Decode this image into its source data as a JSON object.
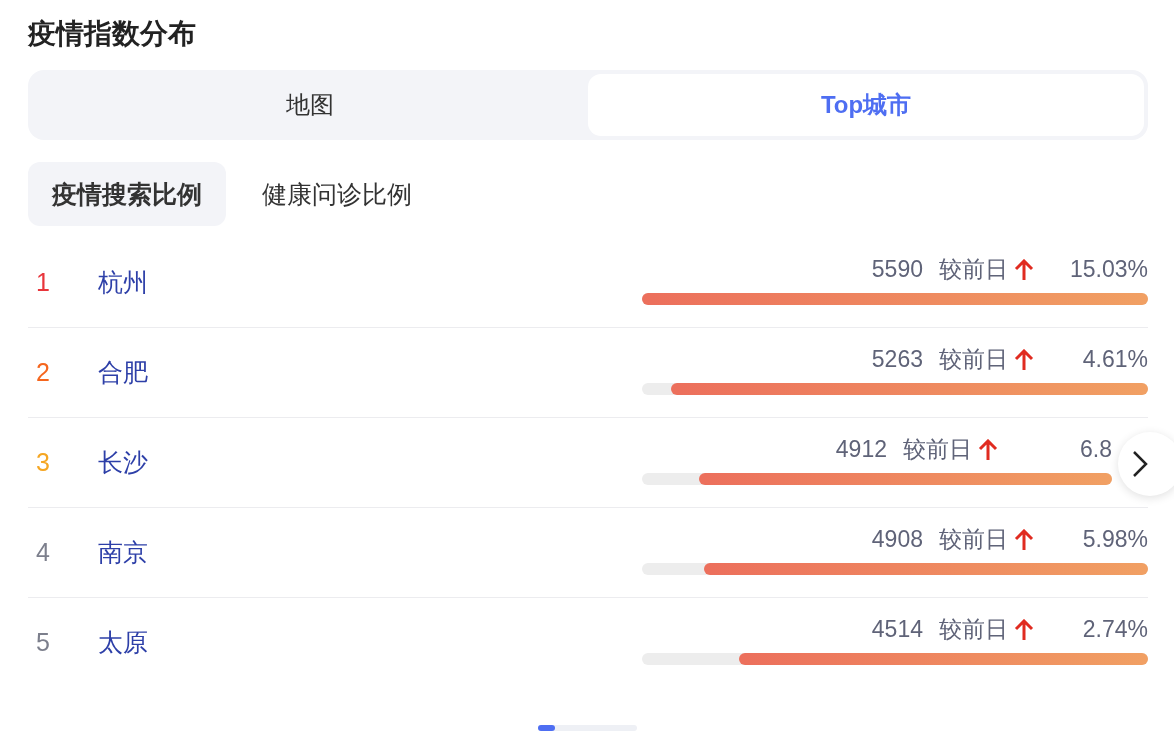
{
  "title": "疫情指数分布",
  "view_tabs": [
    {
      "label": "地图",
      "selected": false
    },
    {
      "label": "Top城市",
      "selected": true
    }
  ],
  "metric_tabs": [
    {
      "label": "疫情搜索比例",
      "selected": true
    },
    {
      "label": "健康问诊比例",
      "selected": false
    }
  ],
  "rows": [
    {
      "rank": "1",
      "color": "#e8353b",
      "city": "杭州",
      "value": "5590",
      "compare": "较前日",
      "rising": true,
      "percent": "15.03%",
      "level": 1.0
    },
    {
      "rank": "2",
      "color": "#f5661e",
      "city": "合肥",
      "value": "5263",
      "compare": "较前日",
      "rising": true,
      "percent": "4.61%",
      "level": 0.943
    },
    {
      "rank": "3",
      "color": "#f5a623",
      "city": "长沙",
      "value": "4912",
      "compare": "较前日",
      "rising": true,
      "percent": "6.8",
      "level": 0.879,
      "covered": true
    },
    {
      "rank": "4",
      "color": "#7c7f8c",
      "city": "南京",
      "value": "4908",
      "compare": "较前日",
      "rising": true,
      "percent": "5.98%",
      "level": 0.877
    },
    {
      "rank": "5",
      "color": "#7c7f8c",
      "city": "太原",
      "value": "4514",
      "compare": "较前日",
      "rising": true,
      "percent": "2.74%",
      "level": 0.808
    }
  ],
  "pager": {
    "level": 0.17
  }
}
